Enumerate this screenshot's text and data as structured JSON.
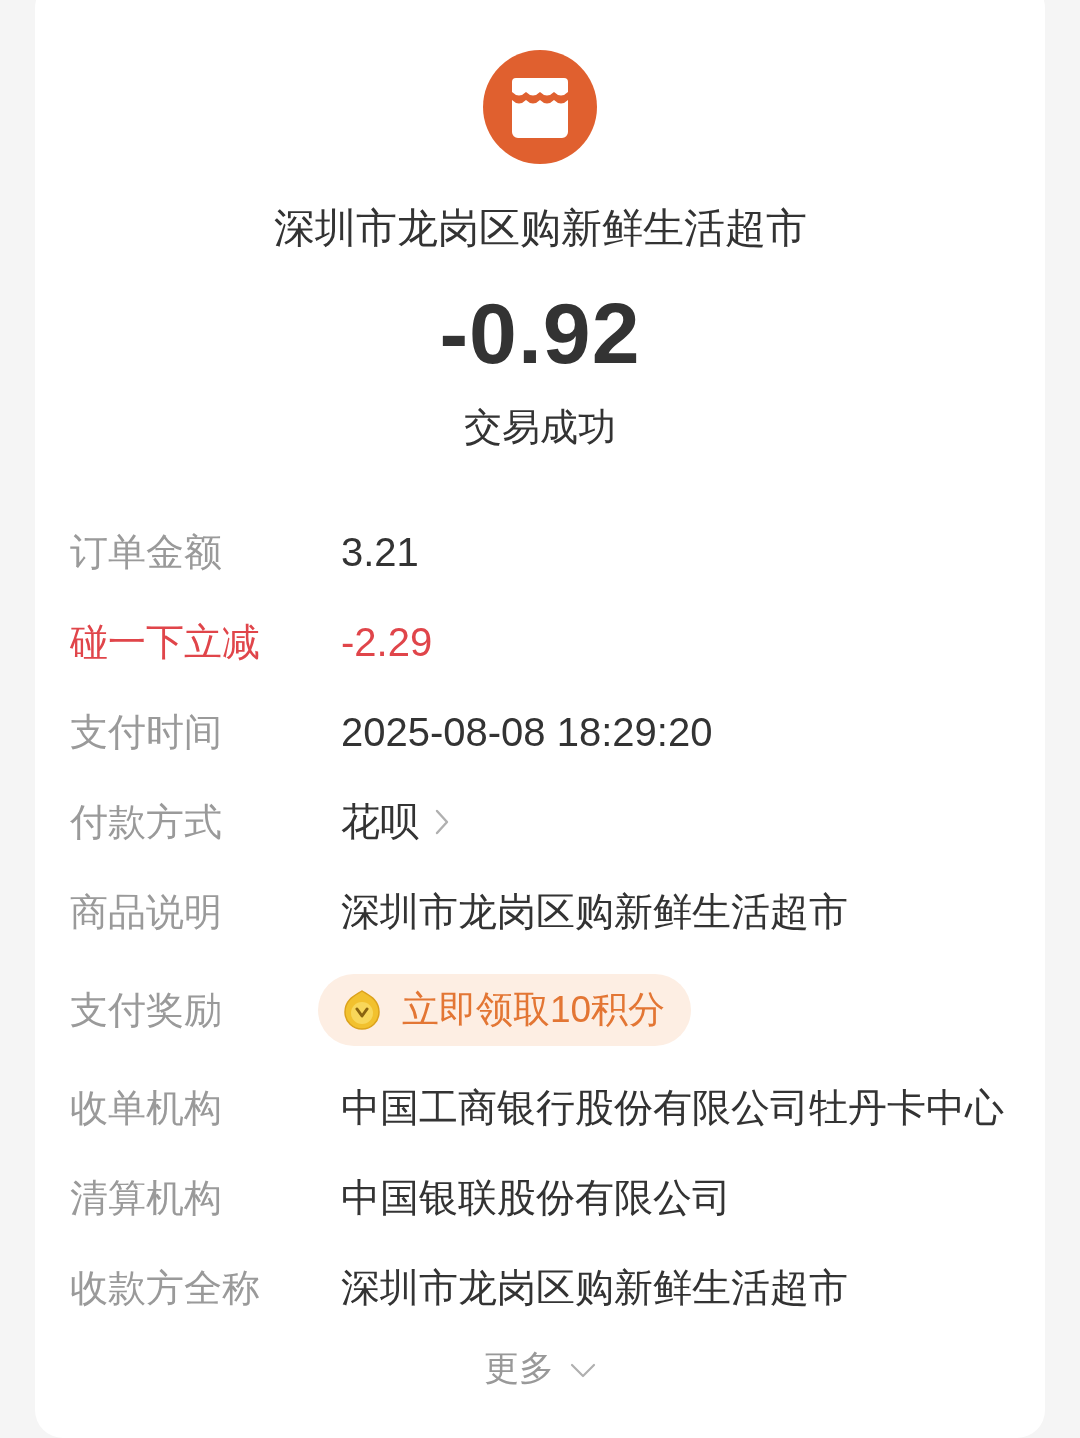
{
  "merchant": {
    "name": "深圳市龙岗区购新鲜生活超市",
    "amount": "-0.92",
    "status": "交易成功"
  },
  "details": [
    {
      "kind": "plain",
      "label": "订单金额",
      "value": "3.21"
    },
    {
      "kind": "discount",
      "label": "碰一下立减",
      "value": "-2.29"
    },
    {
      "kind": "plain",
      "label": "支付时间",
      "value": "2025-08-08 18:29:20"
    },
    {
      "kind": "link",
      "label": "付款方式",
      "value": "花呗"
    },
    {
      "kind": "plain",
      "label": "商品说明",
      "value": "深圳市龙岗区购新鲜生活超市"
    },
    {
      "kind": "reward",
      "label": "支付奖励",
      "value": "立即领取10积分"
    },
    {
      "kind": "plain",
      "label": "收单机构",
      "value": "中国工商银行股份有限公司牡丹卡中心"
    },
    {
      "kind": "plain",
      "label": "清算机构",
      "value": "中国银联股份有限公司"
    },
    {
      "kind": "plain",
      "label": "收款方全称",
      "value": "深圳市龙岗区购新鲜生活超市"
    }
  ],
  "more": {
    "label": "更多"
  }
}
